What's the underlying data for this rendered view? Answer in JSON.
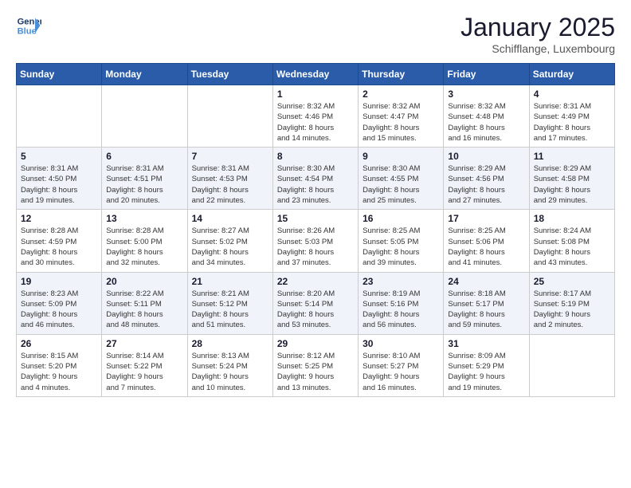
{
  "header": {
    "logo_line1": "General",
    "logo_line2": "Blue",
    "month": "January 2025",
    "location": "Schifflange, Luxembourg"
  },
  "days_of_week": [
    "Sunday",
    "Monday",
    "Tuesday",
    "Wednesday",
    "Thursday",
    "Friday",
    "Saturday"
  ],
  "weeks": [
    [
      {
        "day": "",
        "info": ""
      },
      {
        "day": "",
        "info": ""
      },
      {
        "day": "",
        "info": ""
      },
      {
        "day": "1",
        "info": "Sunrise: 8:32 AM\nSunset: 4:46 PM\nDaylight: 8 hours\nand 14 minutes."
      },
      {
        "day": "2",
        "info": "Sunrise: 8:32 AM\nSunset: 4:47 PM\nDaylight: 8 hours\nand 15 minutes."
      },
      {
        "day": "3",
        "info": "Sunrise: 8:32 AM\nSunset: 4:48 PM\nDaylight: 8 hours\nand 16 minutes."
      },
      {
        "day": "4",
        "info": "Sunrise: 8:31 AM\nSunset: 4:49 PM\nDaylight: 8 hours\nand 17 minutes."
      }
    ],
    [
      {
        "day": "5",
        "info": "Sunrise: 8:31 AM\nSunset: 4:50 PM\nDaylight: 8 hours\nand 19 minutes."
      },
      {
        "day": "6",
        "info": "Sunrise: 8:31 AM\nSunset: 4:51 PM\nDaylight: 8 hours\nand 20 minutes."
      },
      {
        "day": "7",
        "info": "Sunrise: 8:31 AM\nSunset: 4:53 PM\nDaylight: 8 hours\nand 22 minutes."
      },
      {
        "day": "8",
        "info": "Sunrise: 8:30 AM\nSunset: 4:54 PM\nDaylight: 8 hours\nand 23 minutes."
      },
      {
        "day": "9",
        "info": "Sunrise: 8:30 AM\nSunset: 4:55 PM\nDaylight: 8 hours\nand 25 minutes."
      },
      {
        "day": "10",
        "info": "Sunrise: 8:29 AM\nSunset: 4:56 PM\nDaylight: 8 hours\nand 27 minutes."
      },
      {
        "day": "11",
        "info": "Sunrise: 8:29 AM\nSunset: 4:58 PM\nDaylight: 8 hours\nand 29 minutes."
      }
    ],
    [
      {
        "day": "12",
        "info": "Sunrise: 8:28 AM\nSunset: 4:59 PM\nDaylight: 8 hours\nand 30 minutes."
      },
      {
        "day": "13",
        "info": "Sunrise: 8:28 AM\nSunset: 5:00 PM\nDaylight: 8 hours\nand 32 minutes."
      },
      {
        "day": "14",
        "info": "Sunrise: 8:27 AM\nSunset: 5:02 PM\nDaylight: 8 hours\nand 34 minutes."
      },
      {
        "day": "15",
        "info": "Sunrise: 8:26 AM\nSunset: 5:03 PM\nDaylight: 8 hours\nand 37 minutes."
      },
      {
        "day": "16",
        "info": "Sunrise: 8:25 AM\nSunset: 5:05 PM\nDaylight: 8 hours\nand 39 minutes."
      },
      {
        "day": "17",
        "info": "Sunrise: 8:25 AM\nSunset: 5:06 PM\nDaylight: 8 hours\nand 41 minutes."
      },
      {
        "day": "18",
        "info": "Sunrise: 8:24 AM\nSunset: 5:08 PM\nDaylight: 8 hours\nand 43 minutes."
      }
    ],
    [
      {
        "day": "19",
        "info": "Sunrise: 8:23 AM\nSunset: 5:09 PM\nDaylight: 8 hours\nand 46 minutes."
      },
      {
        "day": "20",
        "info": "Sunrise: 8:22 AM\nSunset: 5:11 PM\nDaylight: 8 hours\nand 48 minutes."
      },
      {
        "day": "21",
        "info": "Sunrise: 8:21 AM\nSunset: 5:12 PM\nDaylight: 8 hours\nand 51 minutes."
      },
      {
        "day": "22",
        "info": "Sunrise: 8:20 AM\nSunset: 5:14 PM\nDaylight: 8 hours\nand 53 minutes."
      },
      {
        "day": "23",
        "info": "Sunrise: 8:19 AM\nSunset: 5:16 PM\nDaylight: 8 hours\nand 56 minutes."
      },
      {
        "day": "24",
        "info": "Sunrise: 8:18 AM\nSunset: 5:17 PM\nDaylight: 8 hours\nand 59 minutes."
      },
      {
        "day": "25",
        "info": "Sunrise: 8:17 AM\nSunset: 5:19 PM\nDaylight: 9 hours\nand 2 minutes."
      }
    ],
    [
      {
        "day": "26",
        "info": "Sunrise: 8:15 AM\nSunset: 5:20 PM\nDaylight: 9 hours\nand 4 minutes."
      },
      {
        "day": "27",
        "info": "Sunrise: 8:14 AM\nSunset: 5:22 PM\nDaylight: 9 hours\nand 7 minutes."
      },
      {
        "day": "28",
        "info": "Sunrise: 8:13 AM\nSunset: 5:24 PM\nDaylight: 9 hours\nand 10 minutes."
      },
      {
        "day": "29",
        "info": "Sunrise: 8:12 AM\nSunset: 5:25 PM\nDaylight: 9 hours\nand 13 minutes."
      },
      {
        "day": "30",
        "info": "Sunrise: 8:10 AM\nSunset: 5:27 PM\nDaylight: 9 hours\nand 16 minutes."
      },
      {
        "day": "31",
        "info": "Sunrise: 8:09 AM\nSunset: 5:29 PM\nDaylight: 9 hours\nand 19 minutes."
      },
      {
        "day": "",
        "info": ""
      }
    ]
  ]
}
